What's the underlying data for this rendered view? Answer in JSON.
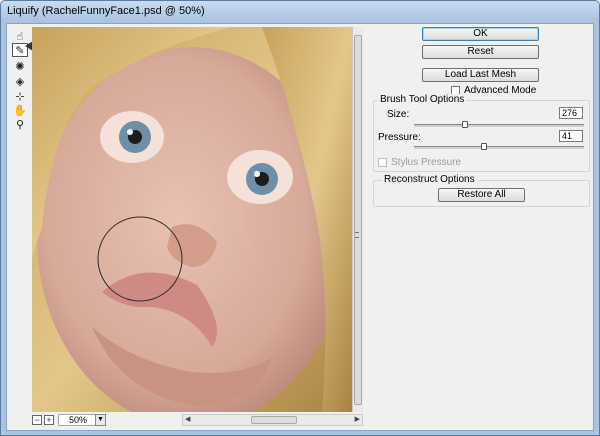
{
  "window": {
    "title": "Liquify (RachelFunnyFace1.psd @ 50%)"
  },
  "tools": [
    {
      "name": "forward-warp-tool",
      "glyph": "☝"
    },
    {
      "name": "reconstruct-tool",
      "glyph": "✎"
    },
    {
      "name": "twirl-tool",
      "glyph": "✺"
    },
    {
      "name": "pucker-tool",
      "glyph": "◈"
    },
    {
      "name": "bloat-tool",
      "glyph": "⊹"
    },
    {
      "name": "hand-tool",
      "glyph": "✋"
    },
    {
      "name": "zoom-tool",
      "glyph": "⚲"
    }
  ],
  "zoom": {
    "value": "50%",
    "minus": "−",
    "plus": "+",
    "dropdown": "▼"
  },
  "buttons": {
    "ok": "OK",
    "reset": "Reset",
    "load_mesh": "Load Last Mesh",
    "restore_all": "Restore All"
  },
  "advanced_mode": {
    "label": "Advanced Mode",
    "checked": false
  },
  "brush_options": {
    "title": "Brush Tool Options",
    "size_label": "Size:",
    "size_value": "276",
    "size_fraction": 0.3,
    "pressure_label": "Pressure:",
    "pressure_value": "41",
    "pressure_fraction": 0.41,
    "stylus_label": "Stylus Pressure",
    "stylus_checked": false
  },
  "reconstruct": {
    "title": "Reconstruct Options"
  }
}
